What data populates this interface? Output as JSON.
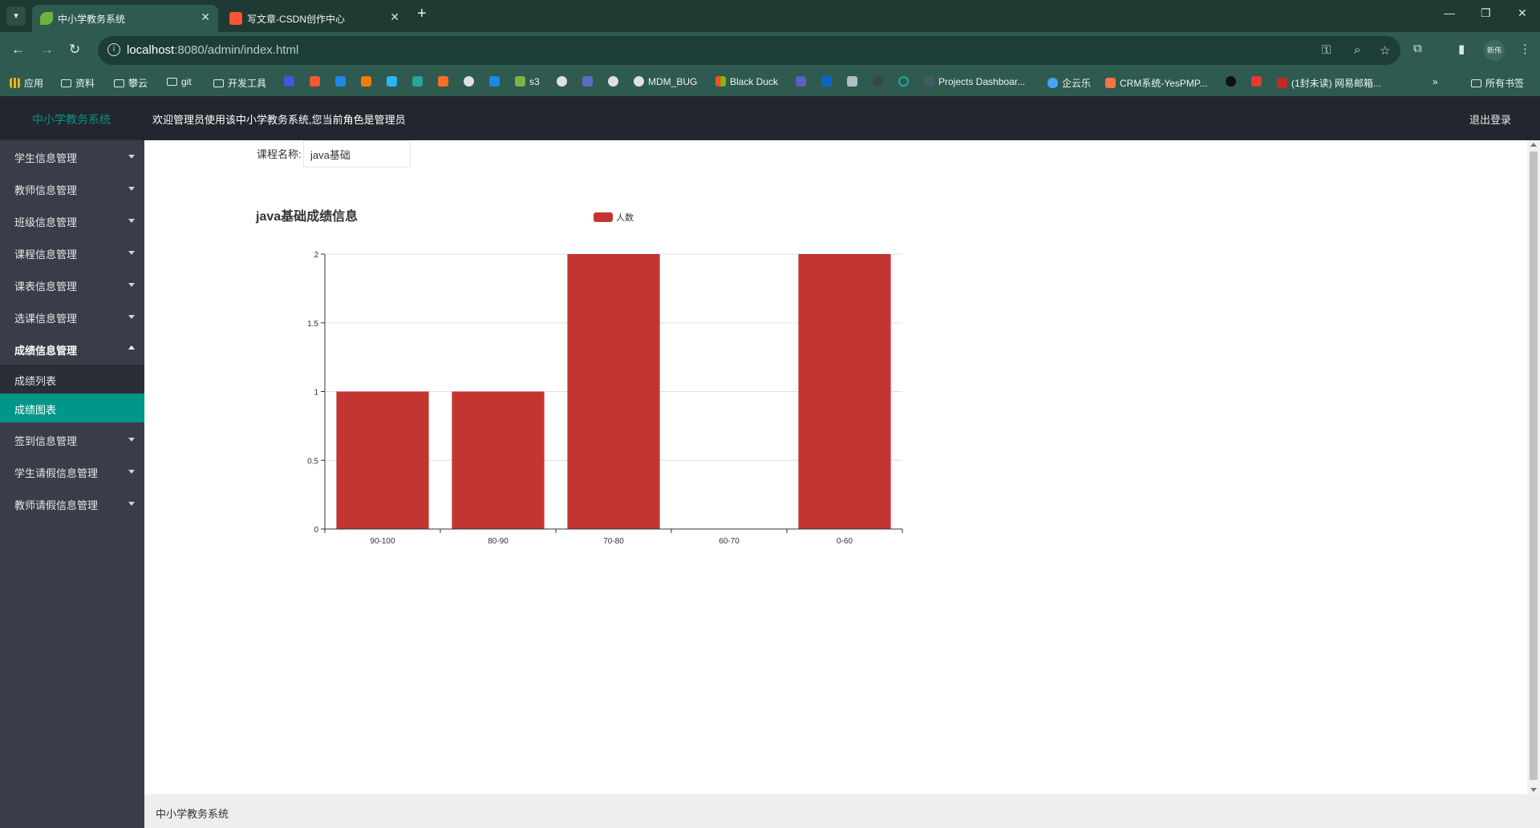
{
  "browser": {
    "tabs": [
      {
        "title": "中小学教务系统",
        "active": true
      },
      {
        "title": "写文章-CSDN创作中心",
        "active": false
      }
    ],
    "url_host": "localhost",
    "url_rest": ":8080/admin/index.html",
    "profile_label": "新伟",
    "bookmarks": [
      "应用",
      "资料",
      "攀云",
      "git",
      "开发工具",
      "s3",
      "MDM_BUG",
      "Black Duck",
      "Projects Dashboar...",
      "企云乐",
      "CRM系统-YesPMP...",
      "(1封未读) 网易邮箱...",
      "所有书签"
    ]
  },
  "header": {
    "logo": "中小学教务系统",
    "welcome": "欢迎管理员使用该中小学教务系统,您当前角色是管理员",
    "logout": "退出登录"
  },
  "sidebar": {
    "items": [
      {
        "label": "学生信息管理"
      },
      {
        "label": "教师信息管理"
      },
      {
        "label": "班级信息管理"
      },
      {
        "label": "课程信息管理"
      },
      {
        "label": "课表信息管理"
      },
      {
        "label": "选课信息管理"
      },
      {
        "label": "成绩信息管理",
        "open": true,
        "children": [
          {
            "label": "成绩列表"
          },
          {
            "label": "成绩图表",
            "active": true
          }
        ]
      },
      {
        "label": "签到信息管理"
      },
      {
        "label": "学生请假信息管理"
      },
      {
        "label": "教师请假信息管理"
      }
    ]
  },
  "form": {
    "course_label": "课程名称:",
    "course_value": "java基础"
  },
  "chart_data": {
    "type": "bar",
    "title": "java基础成绩信息",
    "legend": [
      "人数"
    ],
    "legend_position": "top-center",
    "categories": [
      "90-100",
      "80-90",
      "70-80",
      "60-70",
      "0-60"
    ],
    "series": [
      {
        "name": "人数",
        "values": [
          1,
          1,
          2,
          0,
          2
        ],
        "color": "#c23531"
      }
    ],
    "y_ticks": [
      "0",
      "0.5",
      "1",
      "1.5",
      "2"
    ],
    "ylim": [
      0,
      2
    ],
    "grid": true
  },
  "footer": {
    "text": "中小学教务系统"
  },
  "colors": {
    "accent": "#009688",
    "bar": "#c23531",
    "header_bg": "#23262e",
    "sidebar_bg": "#393d49"
  }
}
